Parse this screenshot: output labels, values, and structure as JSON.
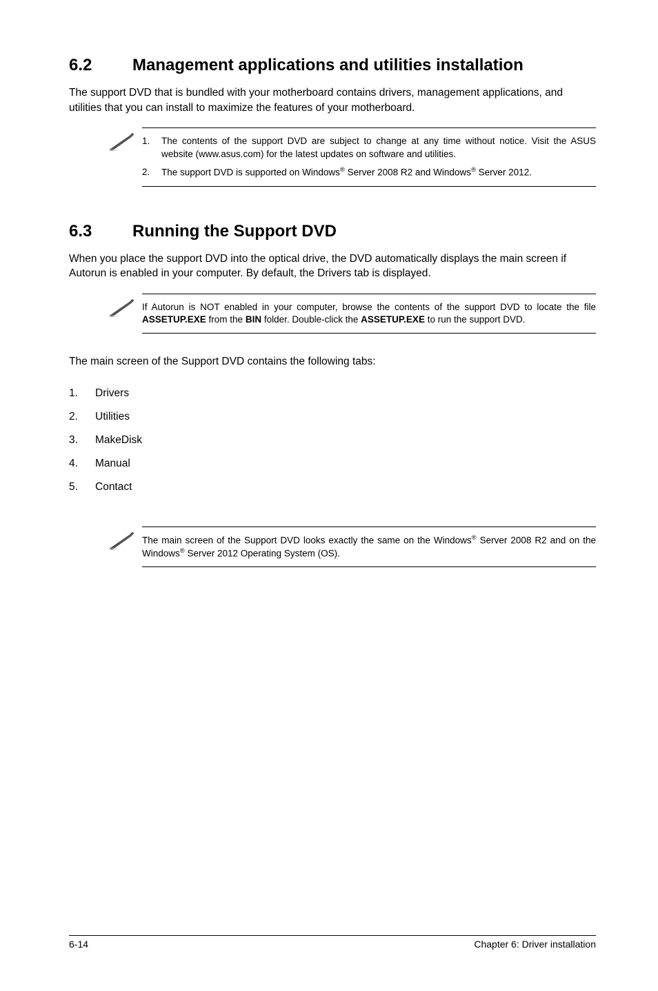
{
  "section62": {
    "num": "6.2",
    "title": "Management applications and utilities installation",
    "body": "The support DVD that is bundled with your motherboard contains drivers, management applications, and utilities that you can install to maximize the features of your motherboard.",
    "notes": [
      {
        "n": "1.",
        "text_plain": "The contents of the support DVD are subject to change at any time without notice. Visit the ASUS website (www.asus.com) for the latest updates on software and utilities."
      },
      {
        "n": "2.",
        "text_html": "The support DVD is supported on Windows<span class='sup'>®</span> Server 2008 R2 and Windows<span class='sup'>®</span> Server 2012."
      }
    ]
  },
  "section63": {
    "num": "6.3",
    "title": "Running the Support DVD",
    "body": "When you place the support DVD into the optical drive, the DVD automatically displays the main screen if Autorun is enabled in your computer. By default, the Drivers tab is displayed.",
    "note_html": "If Autorun is NOT enabled in your computer, browse the contents of the support DVD to locate the file <b>ASSETUP.EXE</b> from the <b>BIN</b> folder. Double-click the <b>ASSETUP.EXE</b> to run the support DVD.",
    "list_intro": "The main screen of the Support DVD contains the following tabs:",
    "list": [
      {
        "n": "1.",
        "label": "Drivers"
      },
      {
        "n": "2.",
        "label": "Utilities"
      },
      {
        "n": "3.",
        "label": "MakeDisk"
      },
      {
        "n": "4.",
        "label": "Manual"
      },
      {
        "n": "5.",
        "label": "Contact"
      }
    ],
    "note2_html": "The main screen of the Support DVD looks exactly the same on the Windows<span class='sup'>®</span> Server 2008 R2 and on the Windows<span class='sup'>®</span> Server 2012 Operating System (OS)."
  },
  "footer": {
    "left": "6-14",
    "right": "Chapter 6: Driver installation"
  }
}
